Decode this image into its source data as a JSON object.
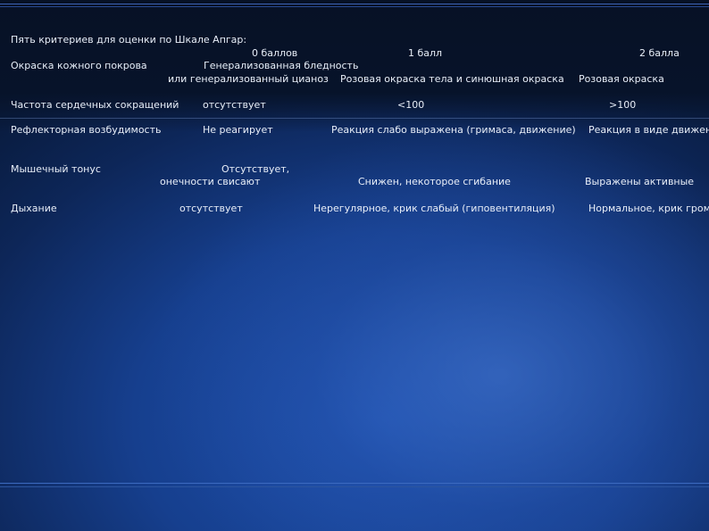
{
  "slide": {
    "title": "Пять критериев для оценки по Шкале Апгар:",
    "headers": {
      "score0": "0 баллов",
      "score1": "1 балл",
      "score2": "2 балла"
    },
    "rows": [
      {
        "criterion": "Окраска кожного покрова",
        "score0_line1": "Генерализованная бледность",
        "score0_line2": "или генерализованный цианоз",
        "score1": "Розовая окраска тела и синюшная окраска",
        "score2": "Розовая окраска"
      },
      {
        "criterion": "Частота сердечных сокращений",
        "score0": "отсутствует",
        "score1": "<100",
        "score2": ">100"
      },
      {
        "criterion": "Рефлекторная возбудимость",
        "score0": "Не реагирует",
        "score1": "Реакция слабо выражена (гримаса, движение)",
        "score2": "Реакция в виде движения"
      },
      {
        "criterion": "Мышечный тонус",
        "score0_line1": "Отсутствует,",
        "score0_line2": "онечности свисают",
        "score1": "Снижен, некоторое сгибание",
        "score2": "Выражены активные"
      },
      {
        "criterion": "Дыхание",
        "score0": "отсутствует",
        "score1": "Нерегулярное, крик слабый (гиповентиляция)",
        "score2": "Нормальное, крик громкий"
      }
    ]
  }
}
